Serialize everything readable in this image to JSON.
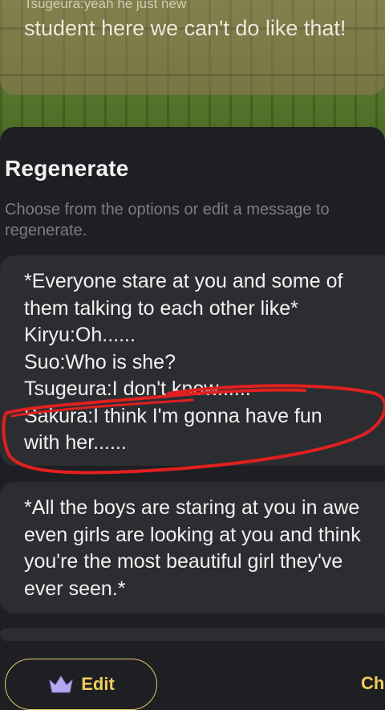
{
  "background_message": {
    "cut_line": "Tsugeura:yeah he just new",
    "text": "student here we can't do like that!"
  },
  "regenerate_sheet": {
    "title": "Regenerate",
    "subtitle": "Choose from the options or edit a message to regenerate.",
    "options": [
      {
        "lines": [
          "*Everyone stare at you and some of",
          "them talking to each other like*",
          "Kiryu:Oh......",
          "Suo:Who is she?",
          "Tsugeura:I don't know......",
          "Sakura:I think I'm gonna have fun",
          "with her......"
        ]
      },
      {
        "lines": [
          "*All the boys are staring at you in awe",
          "even girls are looking at you and think",
          "you're the most beautiful girl they've",
          "ever seen.*"
        ]
      }
    ],
    "edit_button_label": "Edit",
    "choose_button_label": "Ch"
  },
  "colors": {
    "accent": "#f0cc5a",
    "annotation": "#e02020"
  },
  "icons": {
    "edit": "crown-icon"
  }
}
